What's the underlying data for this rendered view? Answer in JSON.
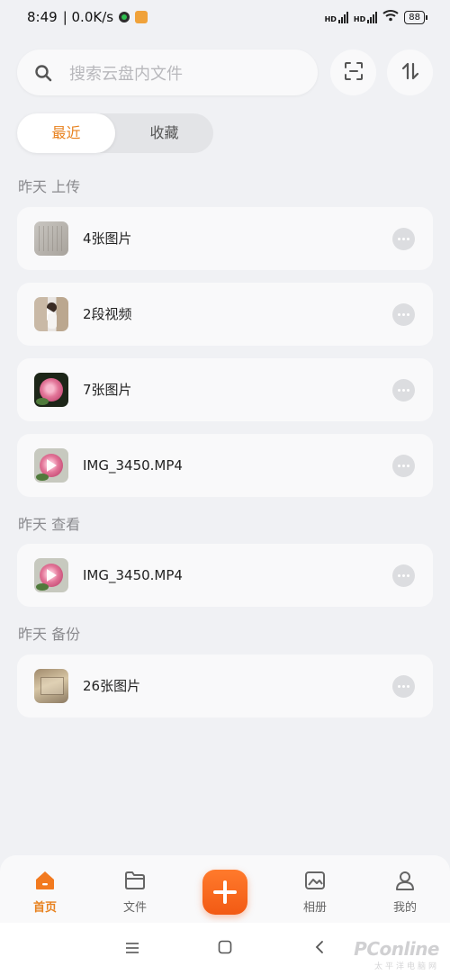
{
  "status_bar": {
    "time": "8:49",
    "net_speed": "| 0.0K/s",
    "signal1_label": "HD",
    "signal2_label": "HD",
    "battery": "88"
  },
  "search": {
    "placeholder": "搜索云盘内文件"
  },
  "header_buttons": {
    "scan_icon": "scan-icon",
    "sort_icon": "sort-icon"
  },
  "tabs": [
    {
      "label": "最近",
      "active": true
    },
    {
      "label": "收藏",
      "active": false
    }
  ],
  "sections": [
    {
      "label": "昨天 上传",
      "items": [
        {
          "name": "4张图片",
          "thumb": "documents-photo"
        },
        {
          "name": "2段视频",
          "thumb": "girl-video"
        },
        {
          "name": "7张图片",
          "thumb": "rose-photo"
        },
        {
          "name": "IMG_3450.MP4",
          "thumb": "rose-video"
        }
      ]
    },
    {
      "label": "昨天 查看",
      "items": [
        {
          "name": "IMG_3450.MP4",
          "thumb": "rose-video"
        }
      ]
    },
    {
      "label": "昨天 备份",
      "items": [
        {
          "name": "26张图片",
          "thumb": "box-photo"
        }
      ]
    }
  ],
  "bottom_nav": [
    {
      "label": "首页",
      "icon": "home-icon",
      "active": true
    },
    {
      "label": "文件",
      "icon": "folder-icon",
      "active": false
    },
    {
      "label": "相册",
      "icon": "album-icon",
      "active": false
    },
    {
      "label": "我的",
      "icon": "profile-icon",
      "active": false
    }
  ],
  "add_button": {
    "icon": "plus-icon"
  },
  "watermark": {
    "brand": "PConline",
    "sub": "太平洋电脑网"
  },
  "colors": {
    "accent": "#e8821f",
    "add_button": "#f25a14",
    "background": "#f0f1f4"
  }
}
